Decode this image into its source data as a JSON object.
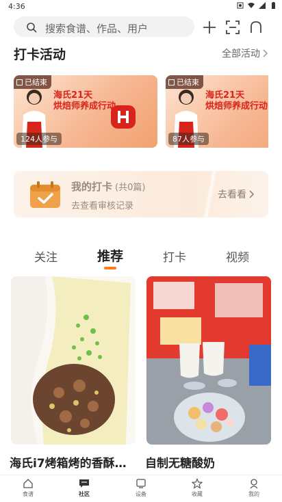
{
  "status_bar": {
    "time": "4:36"
  },
  "search": {
    "placeholder": "搜索食谱、作品、用户"
  },
  "checkin_activity": {
    "title": "打卡活动",
    "more_label": "全部活动",
    "campaigns": [
      {
        "badge": "已结束",
        "title_line1": "海氏21天",
        "title_line2": "烘焙师养成行动",
        "participants": "124人参与"
      },
      {
        "badge": "已结束",
        "title_line1": "海氏21天",
        "title_line2": "烘焙师养成行动",
        "participants": "87人参与"
      }
    ]
  },
  "my_checkin": {
    "title": "我的打卡",
    "count": "(共0篇)",
    "subtitle": "去查看审核记录",
    "action": "去看看"
  },
  "tabs": [
    {
      "label": "关注",
      "active": false
    },
    {
      "label": "推荐",
      "active": true
    },
    {
      "label": "打卡",
      "active": false
    },
    {
      "label": "视频",
      "active": false
    }
  ],
  "feed": [
    {
      "title": "海氏i7烤箱烤的香酥…"
    },
    {
      "title": "自制无糖酸奶"
    }
  ],
  "bottom_nav": [
    {
      "label": "食谱",
      "icon": "home-icon",
      "active": false
    },
    {
      "label": "社区",
      "icon": "chat-icon",
      "active": true
    },
    {
      "label": "设备",
      "icon": "device-icon",
      "active": false
    },
    {
      "label": "收藏",
      "icon": "star-icon",
      "active": false
    },
    {
      "label": "我的",
      "icon": "profile-icon",
      "active": false
    }
  ],
  "colors": {
    "accent": "#ff7a1a",
    "banner_red": "#d9241c"
  }
}
